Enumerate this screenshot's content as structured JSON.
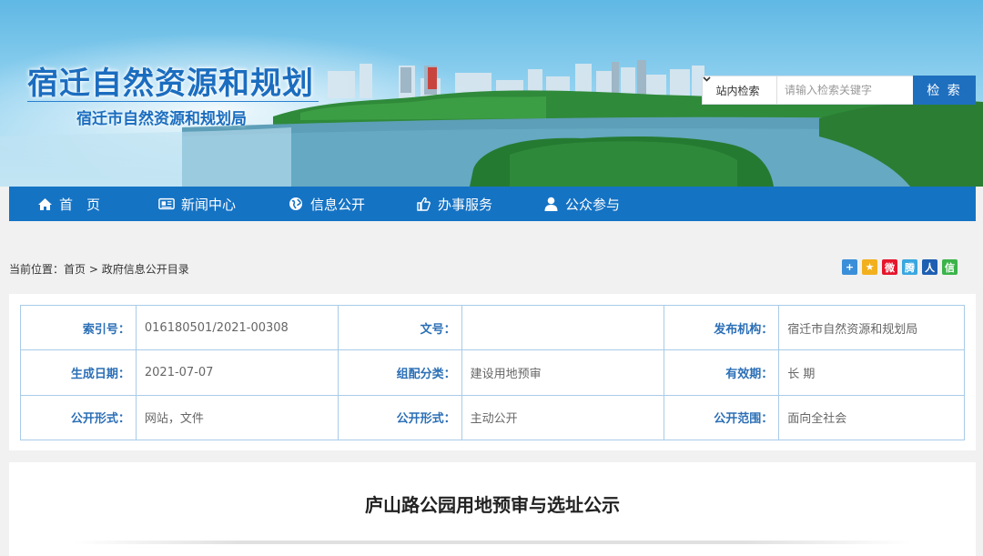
{
  "header": {
    "site_title": "宿迁自然资源和规划",
    "site_subtitle": "宿迁市自然资源和规划局"
  },
  "search": {
    "scope_label": "站内检索",
    "placeholder": "请输入检索关键字",
    "button_label": "检 索"
  },
  "nav": {
    "items": [
      {
        "label": "首　页",
        "icon": "home-icon"
      },
      {
        "label": "新闻中心",
        "icon": "newspaper-icon"
      },
      {
        "label": "信息公开",
        "icon": "globe-icon"
      },
      {
        "label": "办事服务",
        "icon": "thumbs-up-icon"
      },
      {
        "label": "公众参与",
        "icon": "user-icon"
      }
    ]
  },
  "breadcrumb": {
    "prefix": "当前位置：",
    "items": [
      "首页",
      "政府信息公开目录"
    ],
    "separator": " > "
  },
  "share_icons": [
    {
      "name": "share-more-icon",
      "color": "#3b8fd9",
      "glyph": "+"
    },
    {
      "name": "qzone-icon",
      "color": "#f2b01e",
      "glyph": "★"
    },
    {
      "name": "weibo-icon",
      "color": "#e6162d",
      "glyph": "微"
    },
    {
      "name": "tencent-weibo-icon",
      "color": "#3aa7e0",
      "glyph": "腾"
    },
    {
      "name": "renren-icon",
      "color": "#1e5fb2",
      "glyph": "人"
    },
    {
      "name": "wechat-icon",
      "color": "#3bb44a",
      "glyph": "信"
    }
  ],
  "meta": {
    "rows": [
      [
        {
          "label": "索引号：",
          "value": "016180501/2021-00308"
        },
        {
          "label": "文号：",
          "value": ""
        },
        {
          "label": "发布机构：",
          "value": "宿迁市自然资源和规划局"
        }
      ],
      [
        {
          "label": "生成日期：",
          "value": "2021-07-07"
        },
        {
          "label": "组配分类：",
          "value": "建设用地预审"
        },
        {
          "label": "有效期：",
          "value": "长 期"
        }
      ],
      [
        {
          "label": "公开形式：",
          "value": "网站，文件"
        },
        {
          "label": "公开形式：",
          "value": "主动公开"
        },
        {
          "label": "公开范围：",
          "value": "面向全社会"
        }
      ]
    ]
  },
  "article": {
    "title": "庐山路公园用地预审与选址公示"
  }
}
